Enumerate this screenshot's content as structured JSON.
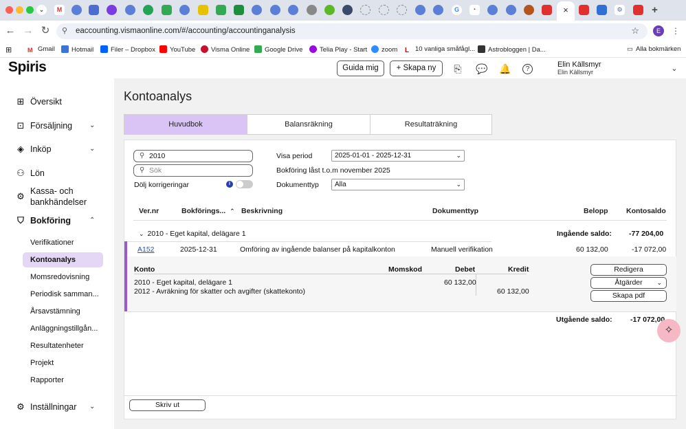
{
  "browser": {
    "active_tab_close": "×",
    "new_tab": "+",
    "url": "eaccounting.vismaonline.com/#/accounting/accountinganalysis",
    "profile_initial": "E",
    "bookmarks": [
      "Gmail",
      "Hotmail",
      "Filer – Dropbox",
      "YouTube",
      "Visma Online",
      "Google Drive",
      "Telia Play - Start",
      "zoom",
      "10 vanliga småfågl...",
      "Astrobloggen | Da..."
    ],
    "all_bookmarks": "Alla bokmärken"
  },
  "header": {
    "logo": "Spiris",
    "guide_label": "Guida mig",
    "create_label": "Skapa ny",
    "user_name": "Elin Källsmyr",
    "user_company": "Elin Källsmyr"
  },
  "sidebar": {
    "items": [
      {
        "label": "Översikt"
      },
      {
        "label": "Försäljning"
      },
      {
        "label": "Inköp"
      },
      {
        "label": "Lön"
      },
      {
        "label": "Kassa- och bankhändelser"
      },
      {
        "label": "Bokföring"
      },
      {
        "label": "Inställningar"
      }
    ],
    "subitems": [
      "Verifikationer",
      "Kontoanalys",
      "Momsredovisning",
      "Periodisk samman...",
      "Årsavstämning",
      "Anläggningstillgån...",
      "Resultatenheter",
      "Projekt",
      "Rapporter"
    ]
  },
  "main": {
    "title": "Kontoanalys",
    "tabs": [
      "Huvudbok",
      "Balansräkning",
      "Resultaträkning"
    ],
    "filters": {
      "account_search": "2010",
      "search_placeholder": "Sök",
      "hide_corrections": "Dölj korrigeringar",
      "period_label": "Visa period",
      "period_value": "2025-01-01 - 2025-12-31",
      "locked_text": "Bokföring låst t.o.m november 2025",
      "doctype_label": "Dokumenttyp",
      "doctype_value": "Alla"
    },
    "columns": [
      "Ver.nr",
      "Bokförings...",
      "Beskrivning",
      "Dokumenttyp",
      "Belopp",
      "Kontosaldo"
    ],
    "group": {
      "name": "2010 - Eget kapital, delägare 1",
      "opening_label": "Ingående saldo:",
      "opening_value": "-77 204,00",
      "closing_label": "Utgående saldo:",
      "closing_value": "-17 072,00"
    },
    "row": {
      "vernr": "A152",
      "date": "2025-12-31",
      "description": "Omföring av ingående balanser på kapitalkonton",
      "doctype": "Manuell verifikation",
      "amount": "60 132,00",
      "balance": "-17 072,00"
    },
    "detail": {
      "columns": [
        "Konto",
        "Momskod",
        "Debet",
        "Kredit"
      ],
      "lines": [
        {
          "account": "2010 - Eget kapital, delägare 1",
          "debit": "60 132,00",
          "credit": ""
        },
        {
          "account": "2012 - Avräkning för skatter och avgifter (skattekonto)",
          "debit": "",
          "credit": "60 132,00"
        }
      ],
      "buttons": {
        "edit": "Redigera",
        "actions": "Åtgärder",
        "pdf": "Skapa pdf"
      }
    },
    "print_label": "Skriv ut"
  },
  "colors": {
    "accent": "#d9c4f5",
    "selected_sidebar": "#e4d7f6",
    "row_marker": "#9b59d0",
    "fab": "#f6b8c4"
  }
}
